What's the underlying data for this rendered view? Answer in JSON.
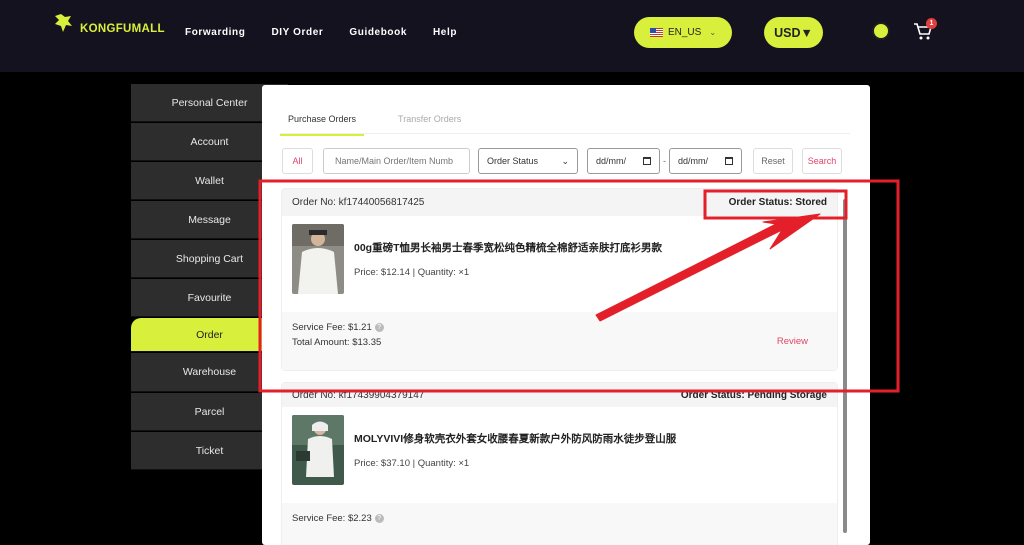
{
  "header": {
    "logo_text": "KONGFUMALL",
    "nav": [
      "Forwarding",
      "DIY Order",
      "Guidebook",
      "Help"
    ],
    "language": "EN_US",
    "currency": "USD▼",
    "cart_count": "1"
  },
  "sidebar": {
    "items": [
      "Personal Center",
      "Account",
      "Wallet",
      "Message",
      "Shopping Cart",
      "Favourite",
      "Order",
      "Warehouse",
      "Parcel",
      "Ticket"
    ],
    "active": "Order"
  },
  "tabs": {
    "purchase": "Purchase Orders",
    "transfer": "Transfer Orders"
  },
  "filters": {
    "all": "All",
    "search_placeholder": "Name/Main Order/Item Numb",
    "status_select": "Order Status",
    "date_from": "dd/mm/",
    "date_to": "dd/mm/",
    "dash": "-",
    "reset": "Reset",
    "search": "Search"
  },
  "orders": [
    {
      "order_no": "Order No: kf17440056817425",
      "status": "Order Status: Stored",
      "title": "00g重磅T恤男长袖男士春季宽松纯色精梳全棉舒适亲肤打底衫男款",
      "price": "Price: $12.14 | Quantity: ×1",
      "service_fee": "Service Fee: $1.21",
      "total": "Total Amount: $13.35",
      "action": "Review"
    },
    {
      "order_no": "Order No: kf17439904379147",
      "status": "Order Status: Pending Storage",
      "title": "MOLYVIVI修身软壳衣外套女收腰春夏新款户外防风防雨水徒步登山服",
      "price": "Price: $37.10 | Quantity: ×1",
      "service_fee": "Service Fee: $2.23"
    }
  ],
  "colors": {
    "accent": "#d8f03c",
    "link_pink": "#e0466a",
    "annotation_red": "#e3202a",
    "topbar": "#14121f"
  }
}
